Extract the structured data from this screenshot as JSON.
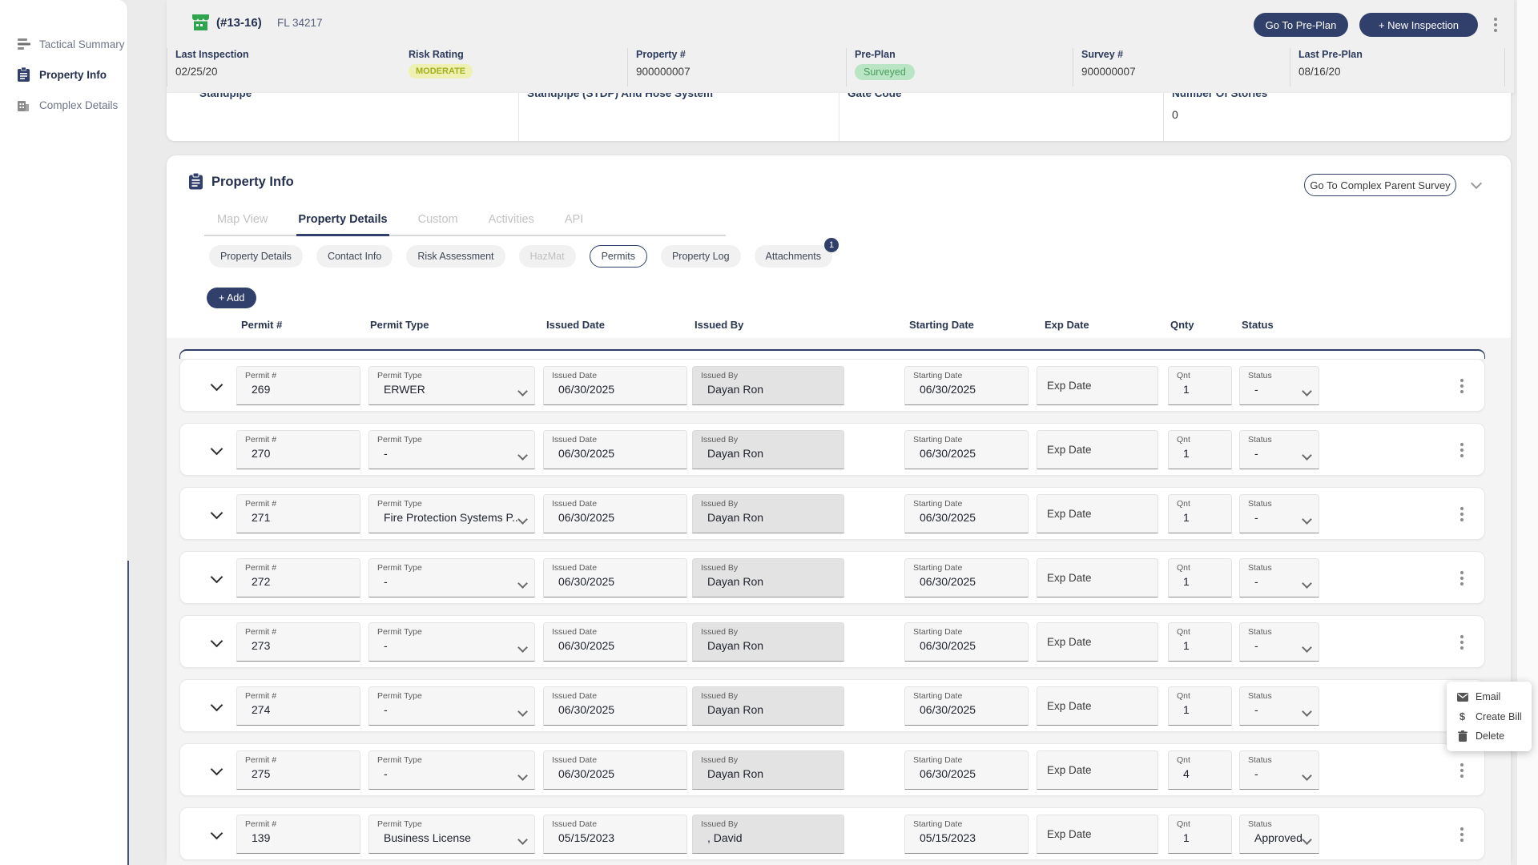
{
  "colors": {
    "navy": "#31406b",
    "store_green": "#2ea44f",
    "risk_badge_bg": "#eef1b2",
    "risk_badge_text": "#a3ae1d",
    "preplan_badge_bg": "#b9e5c4",
    "preplan_badge_text": "#4a9d5e"
  },
  "sidebar": {
    "items": [
      {
        "label": "Tactical Summary",
        "icon": "tactical-summary-icon",
        "active": false
      },
      {
        "label": "Property Info",
        "icon": "property-info-icon",
        "active": true
      },
      {
        "label": "Complex Details",
        "icon": "complex-details-icon",
        "active": false
      }
    ]
  },
  "header": {
    "code": "(#13-16)",
    "location": "FL 34217",
    "go_to_preplan": "Go To Pre-Plan",
    "new_inspection": "+  New Inspection",
    "info": [
      {
        "label": "Risk Rating",
        "value": "MODERATE",
        "badge_class": "badge-yellow"
      },
      {
        "label": "Property #",
        "value": "900000007"
      },
      {
        "label": "Pre-Plan",
        "value": "Surveyed",
        "badge_class": "badge-green"
      },
      {
        "label": "Survey #",
        "value": "900000007"
      },
      {
        "label": "Last Pre-Plan",
        "value": "08/16/20"
      },
      {
        "label": "Last Inspection",
        "value": "02/25/20"
      }
    ]
  },
  "clipped_section": {
    "fields": [
      {
        "label": "Standpipe",
        "value": ""
      },
      {
        "label": "Standpipe (STDP) And Hose System",
        "value": ""
      },
      {
        "label": "Gate Code",
        "value": ""
      },
      {
        "label": "Number Of Stories",
        "value": "0"
      }
    ]
  },
  "property_info": {
    "title": "Property Info",
    "parent_survey_button": "Go To Complex Parent Survey",
    "tabs": [
      {
        "label": "Map View",
        "active": false
      },
      {
        "label": "Property Details",
        "active": true
      },
      {
        "label": "Custom",
        "active": false
      },
      {
        "label": "Activities",
        "active": false
      },
      {
        "label": "API",
        "active": false
      }
    ],
    "chips": [
      {
        "label": "Property Details"
      },
      {
        "label": "Contact Info"
      },
      {
        "label": "Risk Assessment"
      },
      {
        "label": "HazMat",
        "disabled": true
      },
      {
        "label": "Permits",
        "active": true
      },
      {
        "label": "Property Log"
      },
      {
        "label": "Attachments",
        "badge": "1"
      }
    ],
    "add_button": "+ Add"
  },
  "permits": {
    "columns": [
      "Permit #",
      "Permit Type",
      "Issued Date",
      "Issued By",
      "Starting Date",
      "Exp Date",
      "Qnty",
      "Status"
    ],
    "field_labels": {
      "permit": "Permit #",
      "type": "Permit Type",
      "issued_date": "Issued Date",
      "issued_by": "Issued By",
      "starting_date": "Starting Date",
      "exp_date": "Exp Date",
      "qnt": "Qnt",
      "status": "Status"
    },
    "rows": [
      {
        "permit": "269",
        "type": "ERWER",
        "issued_date": "06/30/2025",
        "issued_by": "Dayan Ron",
        "starting_date": "06/30/2025",
        "exp_date": "",
        "qnt": "1",
        "status": "-"
      },
      {
        "permit": "270",
        "type": "-",
        "issued_date": "06/30/2025",
        "issued_by": "Dayan Ron",
        "starting_date": "06/30/2025",
        "exp_date": "",
        "qnt": "1",
        "status": "-"
      },
      {
        "permit": "271",
        "type": "Fire Protection Systems P...",
        "issued_date": "06/30/2025",
        "issued_by": "Dayan Ron",
        "starting_date": "06/30/2025",
        "exp_date": "",
        "qnt": "1",
        "status": "-"
      },
      {
        "permit": "272",
        "type": "-",
        "issued_date": "06/30/2025",
        "issued_by": "Dayan Ron",
        "starting_date": "06/30/2025",
        "exp_date": "",
        "qnt": "1",
        "status": "-"
      },
      {
        "permit": "273",
        "type": "-",
        "issued_date": "06/30/2025",
        "issued_by": "Dayan Ron",
        "starting_date": "06/30/2025",
        "exp_date": "",
        "qnt": "1",
        "status": "-"
      },
      {
        "permit": "274",
        "type": "-",
        "issued_date": "06/30/2025",
        "issued_by": "Dayan Ron",
        "starting_date": "06/30/2025",
        "exp_date": "",
        "qnt": "1",
        "status": "-"
      },
      {
        "permit": "275",
        "type": "-",
        "issued_date": "06/30/2025",
        "issued_by": "Dayan Ron",
        "starting_date": "06/30/2025",
        "exp_date": "",
        "qnt": "4",
        "status": "-"
      },
      {
        "permit": "139",
        "type": "Business License",
        "issued_date": "05/15/2023",
        "issued_by": ", David",
        "starting_date": "05/15/2023",
        "exp_date": "",
        "qnt": "1",
        "status": "Approved"
      }
    ]
  },
  "context_menu": {
    "items": [
      {
        "label": "Email",
        "icon": "email-icon"
      },
      {
        "label": "Create Bill",
        "icon": "dollar-icon"
      },
      {
        "label": "Delete",
        "icon": "trash-icon"
      }
    ]
  }
}
